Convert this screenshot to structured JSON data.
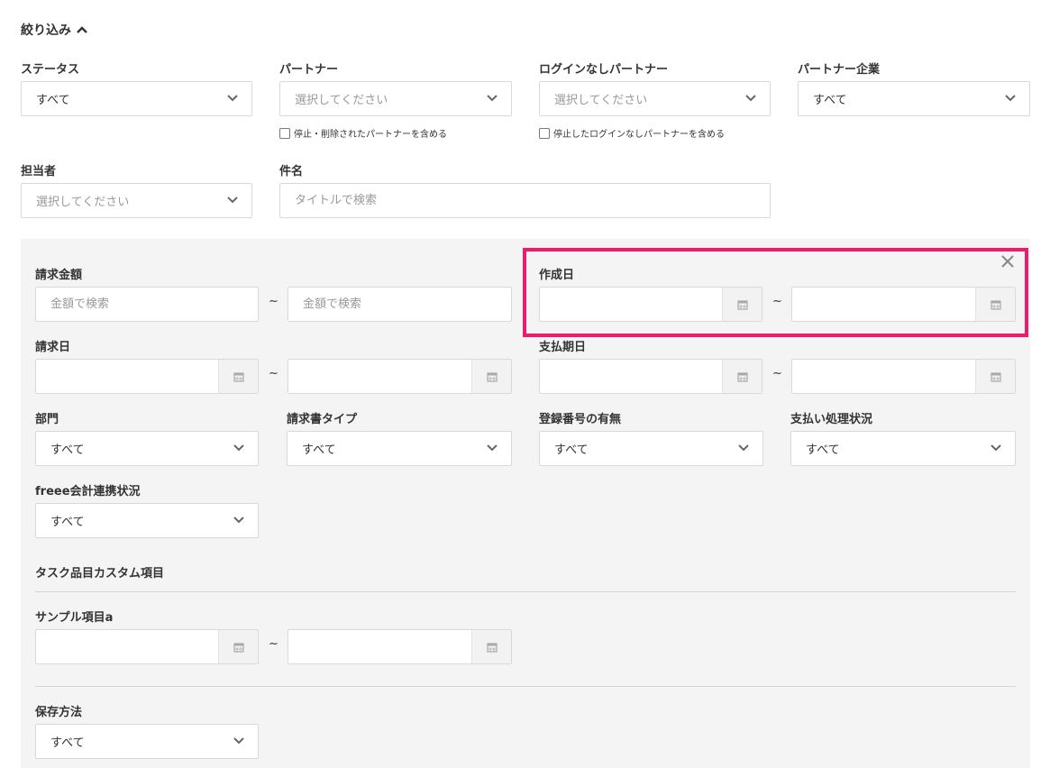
{
  "header": {
    "title": "絞り込み"
  },
  "filters": {
    "status": {
      "label": "ステータス",
      "value": "すべて"
    },
    "partner": {
      "label": "パートナー",
      "placeholder": "選択してください",
      "checkbox_label": "停止・削除されたパートナーを含める"
    },
    "login_less_partner": {
      "label": "ログインなしパートナー",
      "placeholder": "選択してください",
      "checkbox_label": "停止したログインなしパートナーを含める"
    },
    "partner_company": {
      "label": "パートナー企業",
      "value": "すべて"
    },
    "assignee": {
      "label": "担当者",
      "placeholder": "選択してください"
    },
    "subject": {
      "label": "件名",
      "placeholder": "タイトルで検索"
    }
  },
  "advanced": {
    "amount": {
      "label": "請求金額",
      "placeholder": "金額で検索",
      "sep": "~"
    },
    "created_date": {
      "label": "作成日",
      "sep": "~"
    },
    "invoice_date": {
      "label": "請求日",
      "sep": "~"
    },
    "payment_due": {
      "label": "支払期日",
      "sep": "~"
    },
    "department": {
      "label": "部門",
      "value": "すべて"
    },
    "invoice_type": {
      "label": "請求書タイプ",
      "value": "すべて"
    },
    "registration_number": {
      "label": "登録番号の有無",
      "value": "すべて"
    },
    "payment_status": {
      "label": "支払い処理状況",
      "value": "すべて"
    },
    "freee_status": {
      "label": "freee会計連携状況",
      "value": "すべて"
    },
    "custom_section": {
      "title": "タスク品目カスタム項目"
    },
    "sample_item": {
      "label": "サンプル項目a",
      "sep": "~"
    },
    "storage_method": {
      "label": "保存方法",
      "value": "すべて"
    }
  },
  "icons": {
    "chevron": "chevron-down-icon",
    "calendar": "calendar-icon",
    "close": "close-icon",
    "collapse": "chevron-up-icon"
  },
  "colors": {
    "highlight": "#ee1b69",
    "panel": "#f4f4f4"
  }
}
